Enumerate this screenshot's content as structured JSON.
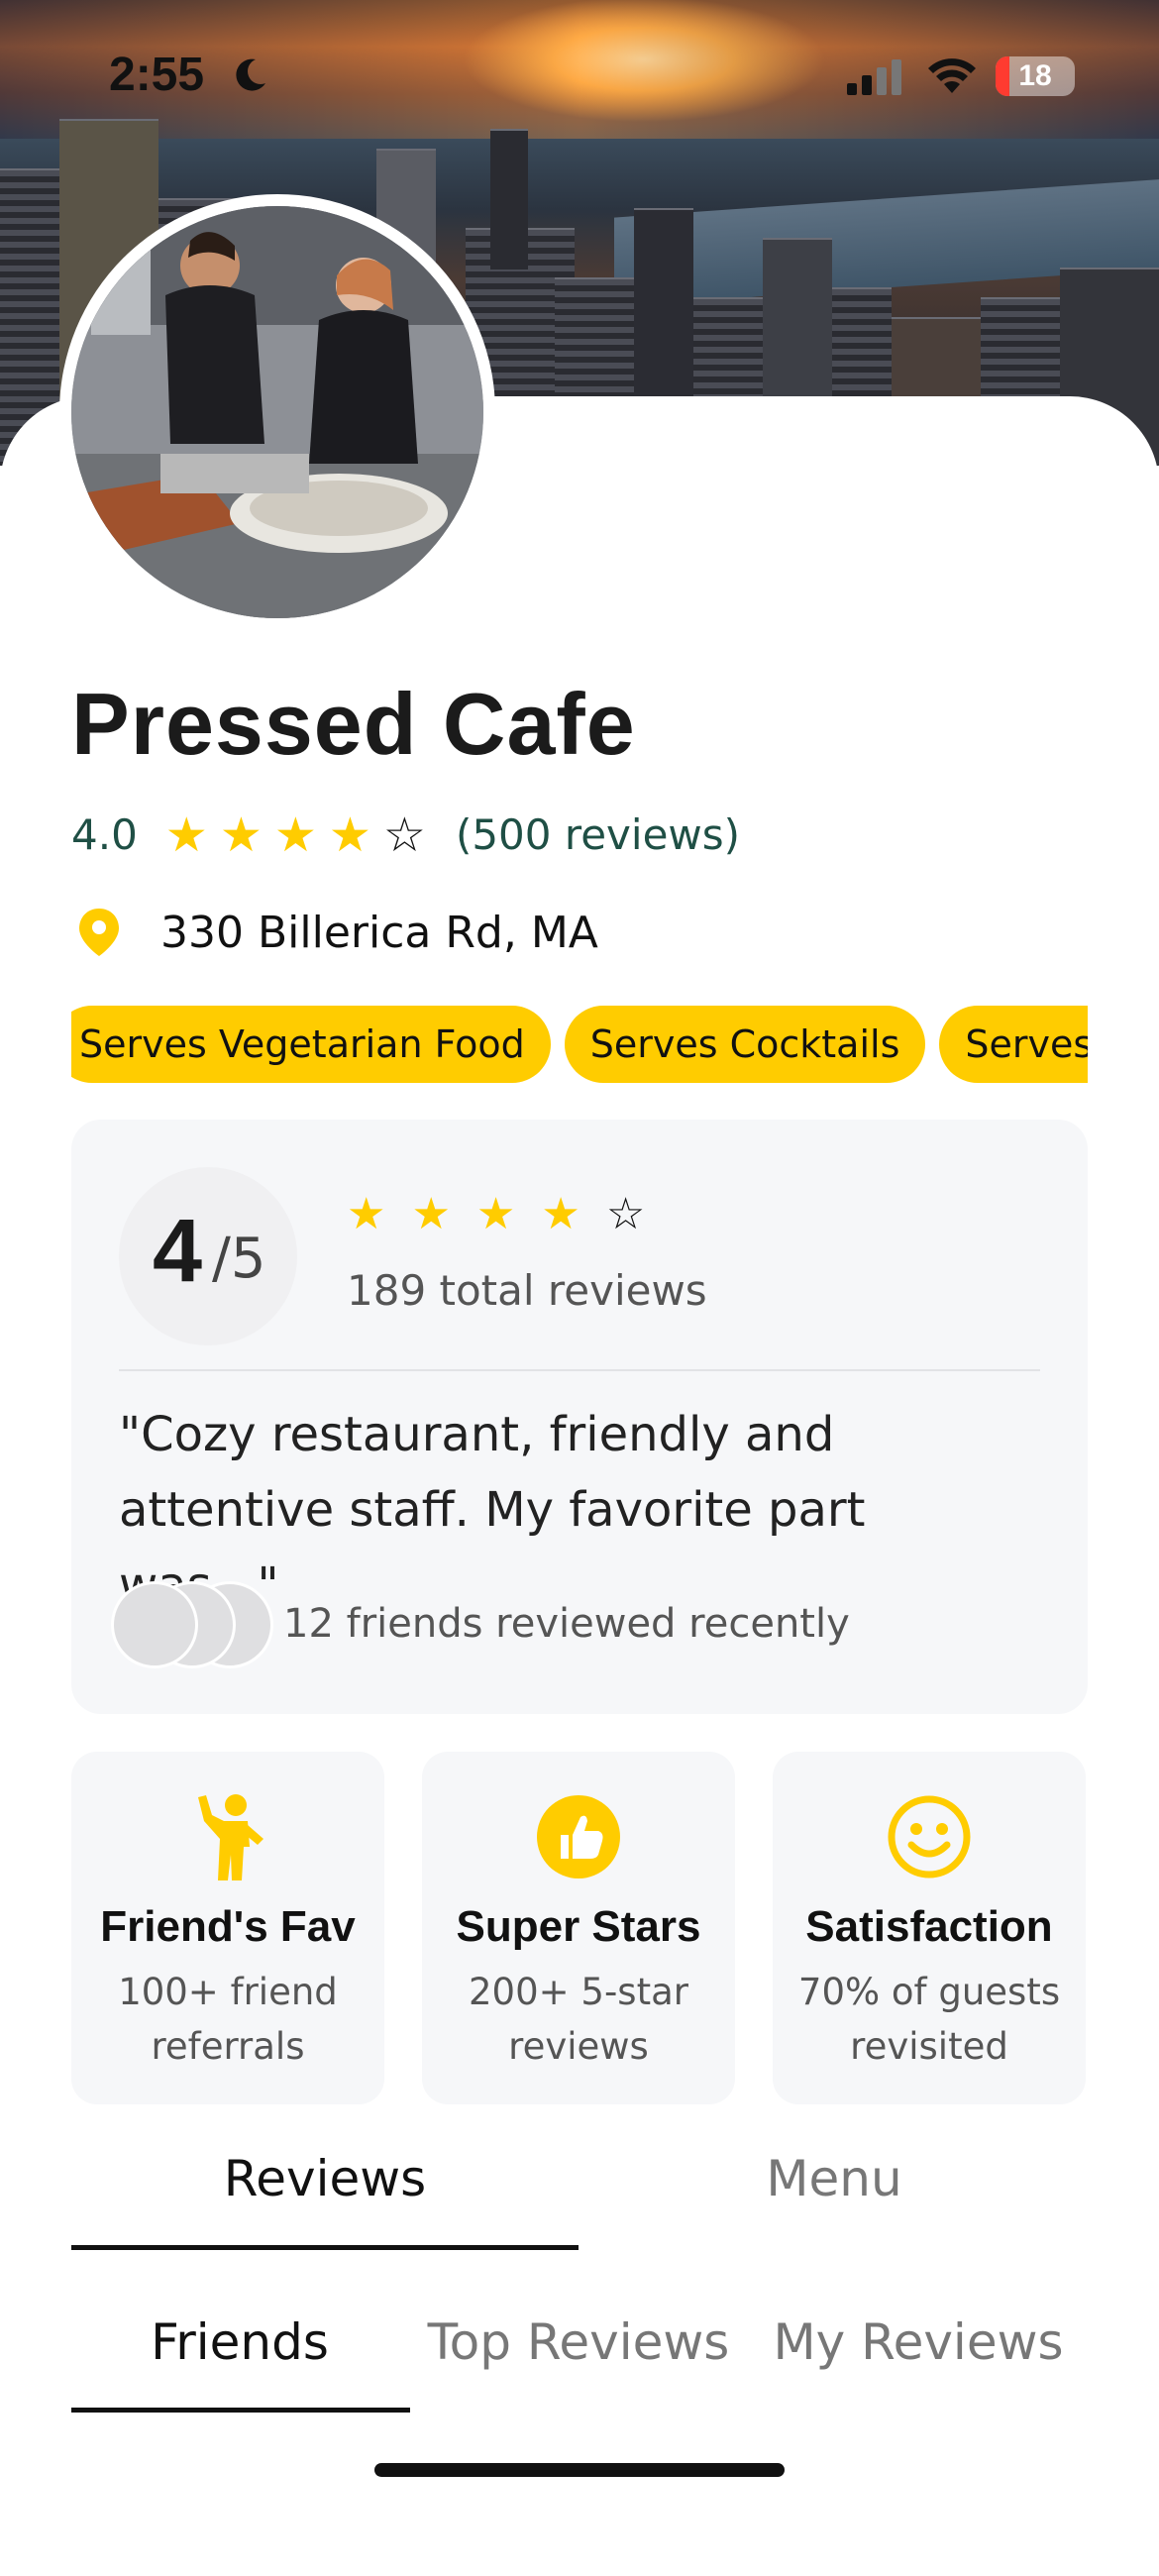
{
  "status_bar": {
    "time": "2:55",
    "battery": "18",
    "battery_level": 0.18
  },
  "restaurant": {
    "name": "Pressed Cafe",
    "rating": "4.0",
    "stars_filled": 4,
    "stars_total": 5,
    "reviews_link": "(500 reviews)",
    "address": "330 Billerica Rd, MA",
    "tags": [
      "Serves Vegetarian Food",
      "Serves Cocktails",
      "Serves Desserts"
    ]
  },
  "summary": {
    "score": "4",
    "score_max": "/5",
    "stars_filled": 4,
    "total_reviews": "189 total reviews",
    "quote": "\"Cozy restaurant, friendly and attentive staff. My favorite part was...\"",
    "friends_text": "12 friends reviewed recently"
  },
  "badges": [
    {
      "icon": "person-waving-icon",
      "title": "Friend's Fav",
      "subtitle": "100+ friend referrals"
    },
    {
      "icon": "thumbs-up-icon",
      "title": "Super Stars",
      "subtitle": "200+ 5-star reviews"
    },
    {
      "icon": "smiley-icon",
      "title": "Satisfaction",
      "subtitle": "70% of guests revisited"
    }
  ],
  "main_tabs": [
    {
      "label": "Reviews",
      "active": true
    },
    {
      "label": "Menu",
      "active": false
    }
  ],
  "sub_tabs": [
    {
      "label": "Friends",
      "active": true
    },
    {
      "label": "Top Reviews",
      "active": false
    },
    {
      "label": "My Reviews",
      "active": false
    }
  ],
  "colors": {
    "accent": "#ffcc00",
    "rating_text": "#1f4f45",
    "card_bg": "#f6f7f9"
  }
}
